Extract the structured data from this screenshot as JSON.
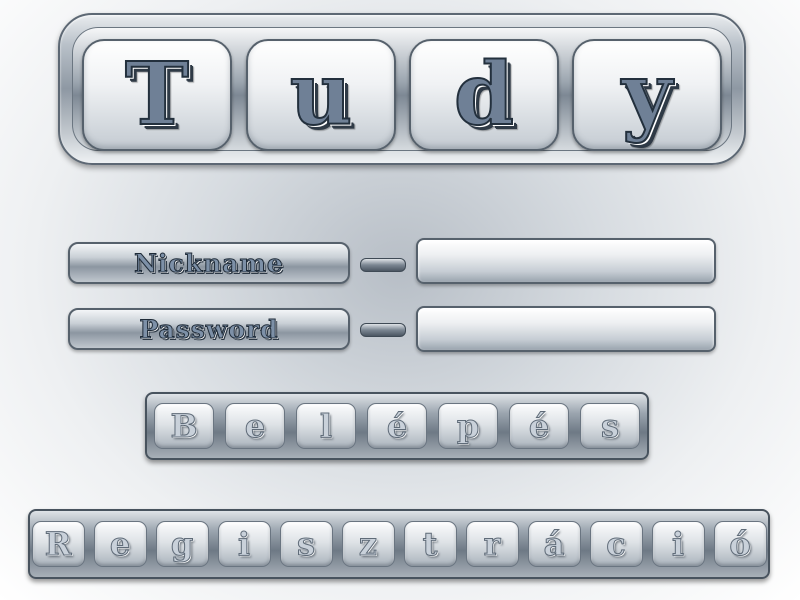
{
  "title": {
    "letters": [
      "T",
      "u",
      "d",
      "y"
    ]
  },
  "form": {
    "nickname": {
      "label": "Nickname",
      "value": "",
      "placeholder": ""
    },
    "password": {
      "label": "Password",
      "value": "",
      "placeholder": ""
    }
  },
  "buttons": {
    "login": {
      "letters": [
        "B",
        "e",
        "l",
        "é",
        "p",
        "é",
        "s"
      ]
    },
    "register": {
      "letters": [
        "R",
        "e",
        "g",
        "i",
        "s",
        "z",
        "t",
        "r",
        "á",
        "c",
        "i",
        "ó"
      ]
    }
  },
  "colors": {
    "accent": "#6f8096",
    "frame": "#56616c",
    "background": "#d6dbe0"
  }
}
